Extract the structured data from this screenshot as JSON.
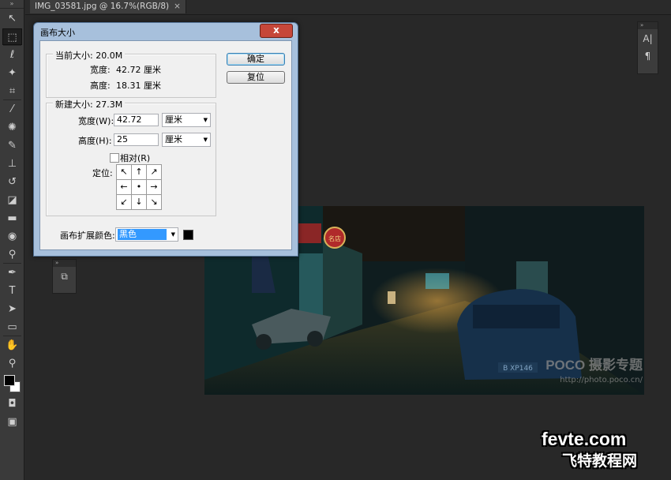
{
  "tab": {
    "title": "IMG_03581.jpg @ 16.7%(RGB/8)",
    "close": "×"
  },
  "toolbar": {
    "grip": "»",
    "tools": [
      {
        "name": "move-tool",
        "glyph": "↖"
      },
      {
        "name": "marquee-tool",
        "glyph": "⬚"
      },
      {
        "name": "lasso-tool",
        "glyph": "ℓ"
      },
      {
        "name": "magic-wand-tool",
        "glyph": "✦"
      },
      {
        "name": "crop-tool",
        "glyph": "⌗"
      },
      {
        "name": "eyedropper-tool",
        "glyph": "⁄"
      },
      {
        "name": "healing-brush-tool",
        "glyph": "✺"
      },
      {
        "name": "brush-tool",
        "glyph": "✎"
      },
      {
        "name": "clone-stamp-tool",
        "glyph": "⊥"
      },
      {
        "name": "history-brush-tool",
        "glyph": "↺"
      },
      {
        "name": "eraser-tool",
        "glyph": "◪"
      },
      {
        "name": "gradient-tool",
        "glyph": "▬"
      },
      {
        "name": "blur-tool",
        "glyph": "◉"
      },
      {
        "name": "dodge-tool",
        "glyph": "⚲"
      },
      {
        "name": "pen-tool",
        "glyph": "✒"
      },
      {
        "name": "type-tool",
        "glyph": "T"
      },
      {
        "name": "path-selection-tool",
        "glyph": "➤"
      },
      {
        "name": "rectangle-tool",
        "glyph": "▭"
      },
      {
        "name": "hand-tool",
        "glyph": "✋"
      },
      {
        "name": "zoom-tool",
        "glyph": "⚲"
      }
    ],
    "quick_mask": "◘",
    "screen_mode": "▣"
  },
  "right_panels": {
    "panel1_header": "»",
    "char_icon": "A|",
    "para_icon": "¶",
    "panel2_header": "»",
    "panel2_icon": "⧉"
  },
  "dialog": {
    "title": "画布大小",
    "close_label": "x",
    "current": {
      "legend": "当前大小: 20.0M",
      "width_label": "宽度:",
      "width_value": "42.72 厘米",
      "height_label": "高度:",
      "height_value": "18.31 厘米"
    },
    "new": {
      "legend": "新建大小: 27.3M",
      "width_label": "宽度(W):",
      "width_value": "42.72",
      "width_unit": "厘米",
      "height_label": "高度(H):",
      "height_value": "25",
      "height_unit": "厘米",
      "relative_label": "相对(R)",
      "relative_checked": false,
      "anchor_label": "定位:",
      "anchor": [
        "↖",
        "↑",
        "↗",
        "←",
        "•",
        "→",
        "↙",
        "↓",
        "↘"
      ]
    },
    "ext_color_label": "画布扩展颜色:",
    "ext_color_value": "黑色",
    "ext_color_swatch": "#000000",
    "ok_label": "确定",
    "reset_label": "复位"
  },
  "photo_overlay": {
    "sign_text": "名店",
    "plate_text": "B XP146",
    "watermark_logo": "POCO 摄影专题",
    "watermark_url": "http://photo.poco.cn/"
  },
  "site_watermark": {
    "logo": "fevte.com",
    "cn": "飞特教程网"
  }
}
